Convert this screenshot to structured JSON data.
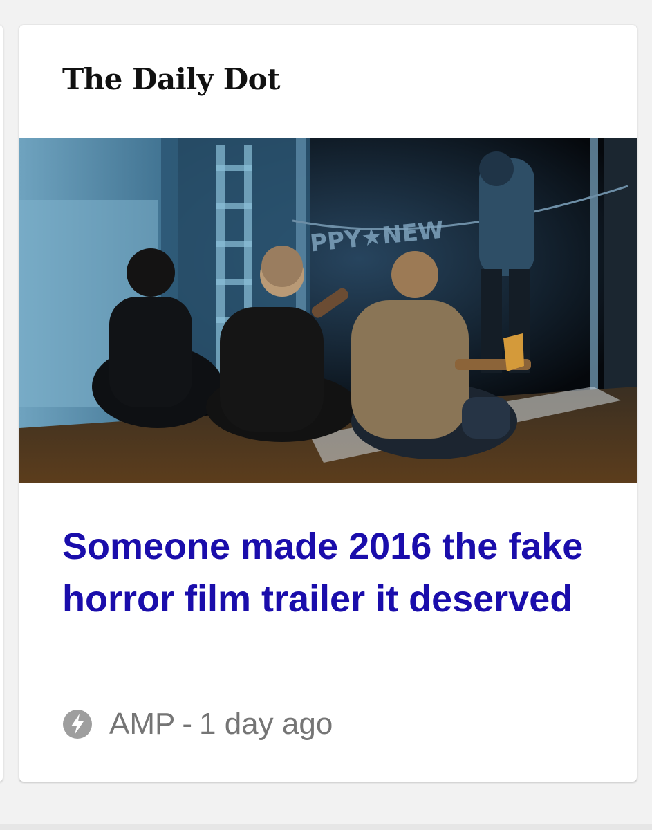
{
  "card": {
    "publisher": "The Daily Dot",
    "image": {
      "icon": "article-thumbnail",
      "banner_text": "PPY★NEW"
    },
    "headline": "Someone made 2016 the fake horror film trailer it deserved",
    "meta": {
      "icon": "amp-lightning-icon",
      "source": "AMP",
      "separator": "-",
      "time": "1 day ago"
    }
  },
  "colors": {
    "headline": "#1a0dab",
    "meta_text": "#757575",
    "background": "#f2f2f2",
    "card": "#ffffff"
  }
}
